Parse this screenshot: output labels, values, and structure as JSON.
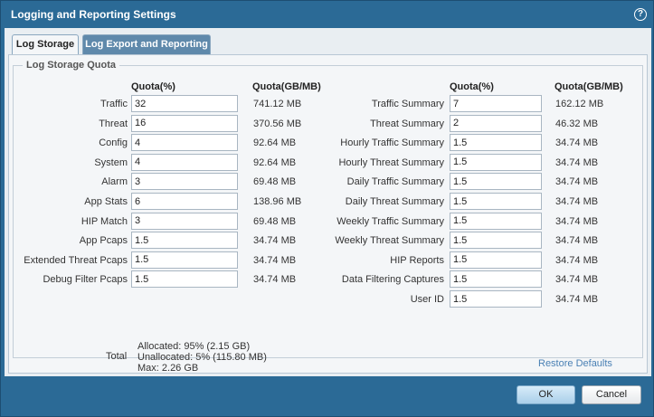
{
  "dialog": {
    "title": "Logging and Reporting Settings",
    "help_icon": "?"
  },
  "tabs": [
    {
      "label": "Log Storage",
      "active": true
    },
    {
      "label": "Log Export and Reporting",
      "active": false
    }
  ],
  "section_title": "Log Storage Quota",
  "headers": {
    "quota_pct": "Quota(%)",
    "quota_size": "Quota(GB/MB)"
  },
  "left_rows": [
    {
      "label": "Traffic",
      "value": "32",
      "size": "741.12 MB"
    },
    {
      "label": "Threat",
      "value": "16",
      "size": "370.56 MB"
    },
    {
      "label": "Config",
      "value": "4",
      "size": "92.64 MB"
    },
    {
      "label": "System",
      "value": "4",
      "size": "92.64 MB"
    },
    {
      "label": "Alarm",
      "value": "3",
      "size": "69.48 MB"
    },
    {
      "label": "App Stats",
      "value": "6",
      "size": "138.96 MB"
    },
    {
      "label": "HIP Match",
      "value": "3",
      "size": "69.48 MB"
    },
    {
      "label": "App Pcaps",
      "value": "1.5",
      "size": "34.74 MB"
    },
    {
      "label": "Extended Threat Pcaps",
      "value": "1.5",
      "size": "34.74 MB"
    },
    {
      "label": "Debug Filter Pcaps",
      "value": "1.5",
      "size": "34.74 MB"
    }
  ],
  "right_rows": [
    {
      "label": "Traffic Summary",
      "value": "7",
      "size": "162.12 MB"
    },
    {
      "label": "Threat Summary",
      "value": "2",
      "size": "46.32 MB"
    },
    {
      "label": "Hourly Traffic Summary",
      "value": "1.5",
      "size": "34.74 MB"
    },
    {
      "label": "Hourly Threat Summary",
      "value": "1.5",
      "size": "34.74 MB"
    },
    {
      "label": "Daily Traffic Summary",
      "value": "1.5",
      "size": "34.74 MB"
    },
    {
      "label": "Daily Threat Summary",
      "value": "1.5",
      "size": "34.74 MB"
    },
    {
      "label": "Weekly Traffic Summary",
      "value": "1.5",
      "size": "34.74 MB"
    },
    {
      "label": "Weekly Threat Summary",
      "value": "1.5",
      "size": "34.74 MB"
    },
    {
      "label": "HIP Reports",
      "value": "1.5",
      "size": "34.74 MB"
    },
    {
      "label": "Data Filtering Captures",
      "value": "1.5",
      "size": "34.74 MB"
    },
    {
      "label": "User ID",
      "value": "1.5",
      "size": "34.74 MB"
    }
  ],
  "total": {
    "label": "Total",
    "allocated": "Allocated: 95% (2.15 GB)",
    "unallocated": "Unallocated: 5% (115.80 MB)",
    "max": "Max: 2.26 GB"
  },
  "restore_defaults": "Restore Defaults",
  "buttons": {
    "ok": "OK",
    "cancel": "Cancel"
  },
  "colors": {
    "titlebar": "#2b6a96",
    "link": "#4a80b4",
    "active_tab": "#f4f6f8",
    "inactive_tab": "#5f89ab"
  }
}
